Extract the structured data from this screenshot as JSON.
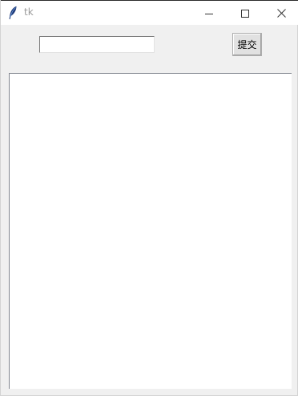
{
  "window": {
    "title": "tk",
    "icon": "feather-icon",
    "controls": {
      "minimize": "minimize-icon",
      "maximize": "maximize-icon",
      "close": "close-icon"
    }
  },
  "form": {
    "entry_value": "",
    "submit_label": "提交"
  },
  "output": {
    "text": ""
  },
  "colors": {
    "titlebar": "#ffffff",
    "client": "#f0f0f0",
    "title_text": "#9a9a9a"
  }
}
